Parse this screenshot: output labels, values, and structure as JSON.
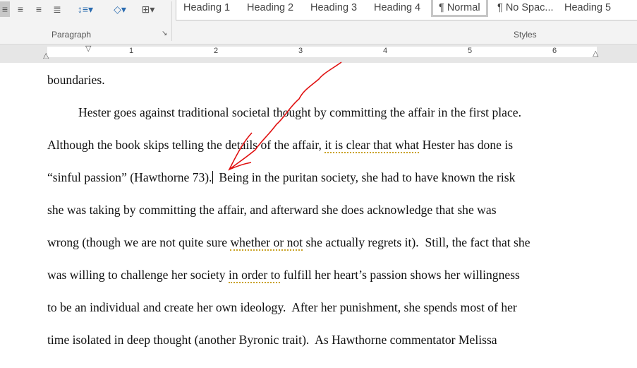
{
  "ribbon": {
    "paragraph_label": "Paragraph",
    "styles_label": "Styles",
    "styles": [
      "Heading 1",
      "Heading 2",
      "Heading 3",
      "Heading 4",
      "¶ Normal",
      "¶ No Spac...",
      "Heading 5"
    ],
    "selected_style": "¶ Normal"
  },
  "ruler": {
    "numbers": [
      "1",
      "2",
      "3",
      "4",
      "5",
      "6"
    ]
  },
  "document": {
    "lines": [
      [
        "boundaries."
      ],
      [
        "          Hester goes against traditional societal thought by committing the affair in the first place."
      ],
      [
        "Although the book skips telling the details of the affair, ",
        "it is clear that what",
        " Hester has done is"
      ],
      [
        "“sinful passion” (Hawthorne 73).",
        "CARET",
        "  Being in the puritan society, she had to have known the risk"
      ],
      [
        "she was taking by committing the affair, and afterward she does acknowledge that she was"
      ],
      [
        "wrong (though we are not quite sure ",
        "whether or not",
        " she actually regrets it).  Still, the fact that she"
      ],
      [
        "was willing to challenge her society ",
        "in order to",
        " fulfill her heart’s passion shows her willingness"
      ],
      [
        "to be an individual and create her own ideology.  After her punishment, she spends most of her"
      ],
      [
        "time isolated in deep thought (another Byronic trait).  As Hawthorne commentator Melissa"
      ]
    ]
  },
  "colors": {
    "annotation": "#e01010",
    "grammar_underline": "#c9a227"
  }
}
